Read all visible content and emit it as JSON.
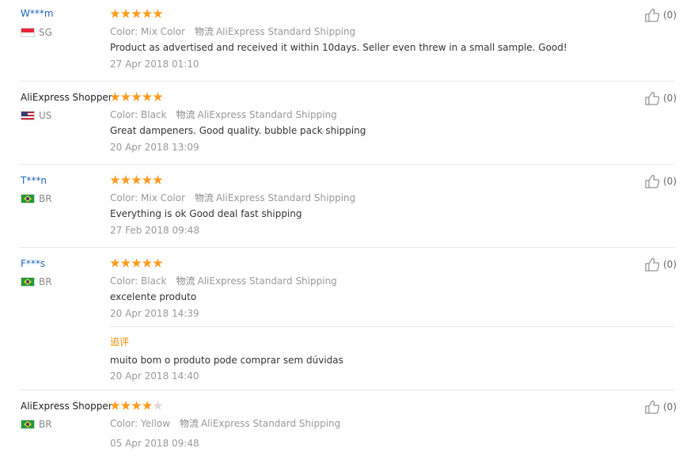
{
  "labels": {
    "color_prefix": "Color:",
    "shipping_icon_text": "物流",
    "followup": "追评"
  },
  "reviews": [
    {
      "user": "W***m",
      "country": "SG",
      "rating": 5,
      "color": "Mix Color",
      "shipping": "AliExpress Standard Shipping",
      "text": "Product as advertised and received it within 10days. Seller even threw in a small sample. Good!",
      "date": "27 Apr 2018 01:10",
      "helpful": "(0)"
    },
    {
      "user": "AliExpress Shopper",
      "country": "US",
      "rating": 5,
      "color": "Black",
      "shipping": "AliExpress Standard Shipping",
      "text": "Great dampeners. Good quality. bubble pack shipping",
      "date": "20 Apr 2018 13:09",
      "helpful": "(0)"
    },
    {
      "user": "T***n",
      "country": "BR",
      "rating": 5,
      "color": "Mix Color",
      "shipping": "AliExpress Standard Shipping",
      "text": "Everything is ok Good deal fast shipping",
      "date": "27 Feb 2018 09:48",
      "helpful": "(0)"
    },
    {
      "user": "F***s",
      "country": "BR",
      "rating": 5,
      "color": "Black",
      "shipping": "AliExpress Standard Shipping",
      "text": "excelente produto",
      "date": "20 Apr 2018 14:39",
      "helpful": "(0)",
      "followup_text": "muito bom o produto pode comprar sem dúvidas",
      "followup_date": "20 Apr 2018 14:40"
    },
    {
      "user": "AliExpress Shopper",
      "country": "BR",
      "rating": 4,
      "color": "Yellow",
      "shipping": "AliExpress Standard Shipping",
      "text": "",
      "date": "05 Apr 2018 09:48",
      "helpful": "(0)"
    }
  ],
  "colors": {
    "star_on": "#ff9a1c",
    "star_off": "#d9d9d9",
    "masked_user": "#1e63b6",
    "followup": "#ff8a00"
  }
}
